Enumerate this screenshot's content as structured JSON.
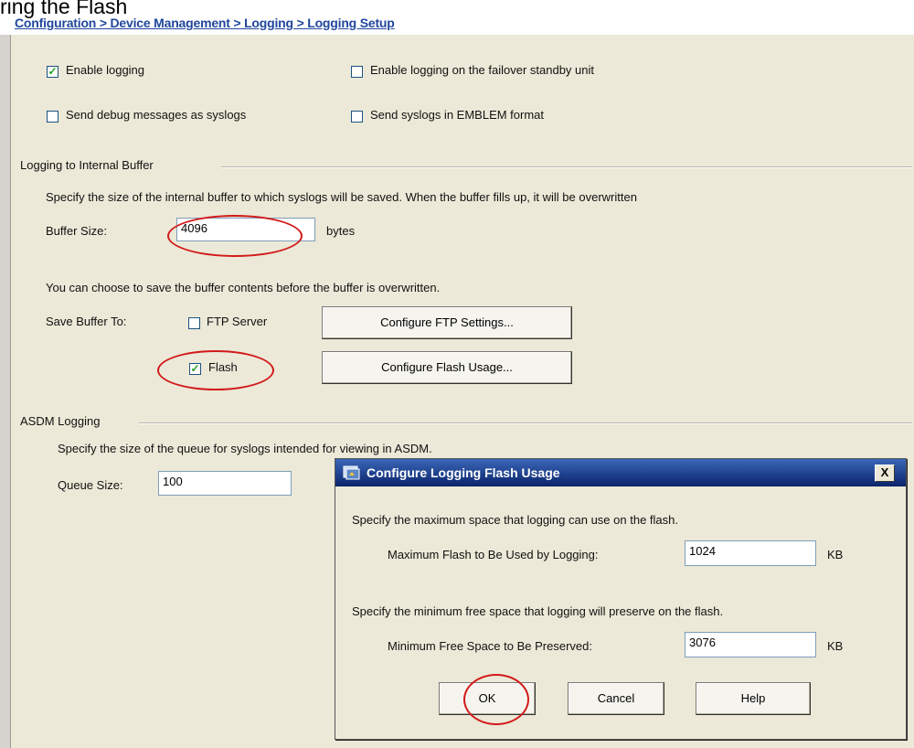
{
  "caption": "ring the Flash",
  "breadcrumb": "Configuration > Device Management > Logging > Logging Setup",
  "options": {
    "enable_logging": {
      "label": "Enable logging",
      "checked": true
    },
    "enable_failover": {
      "label": "Enable logging on the failover standby unit",
      "checked": false
    },
    "send_debug": {
      "label": "Send debug messages as syslogs",
      "checked": false
    },
    "send_emblem": {
      "label": "Send syslogs in EMBLEM format",
      "checked": false
    }
  },
  "internal_buffer": {
    "group_title": "Logging to Internal Buffer",
    "description": "Specify the size of the internal buffer to which syslogs will be saved. When the buffer fills up, it will be overwritten",
    "buffer_size_label": "Buffer Size:",
    "buffer_size_value": "4096",
    "buffer_size_unit": "bytes",
    "save_note": "You can choose to save the buffer contents before the buffer is overwritten.",
    "save_to_label": "Save Buffer To:",
    "ftp_label": "FTP Server",
    "ftp_checked": false,
    "configure_ftp_button": "Configure FTP Settings...",
    "flash_label": "Flash",
    "flash_checked": true,
    "configure_flash_button": "Configure Flash Usage..."
  },
  "asdm": {
    "group_title": "ASDM Logging",
    "description": "Specify the size of the queue for syslogs intended for viewing in ASDM.",
    "queue_size_label": "Queue Size:",
    "queue_size_value": "100"
  },
  "dialog": {
    "title": "Configure Logging Flash Usage",
    "close_label": "X",
    "max_note": "Specify the maximum space that logging can use on the flash.",
    "max_label": "Maximum Flash to Be Used by Logging:",
    "max_value": "1024",
    "max_unit": "KB",
    "min_note": "Specify the minimum free space that logging will preserve on the flash.",
    "min_label": "Minimum Free Space to Be Preserved:",
    "min_value": "3076",
    "min_unit": "KB",
    "ok_button": "OK",
    "cancel_button": "Cancel",
    "help_button": "Help"
  },
  "colors": {
    "annotation": "#d21a1a",
    "breadcrumb": "#21479c",
    "title_bar": "#0a246a"
  }
}
